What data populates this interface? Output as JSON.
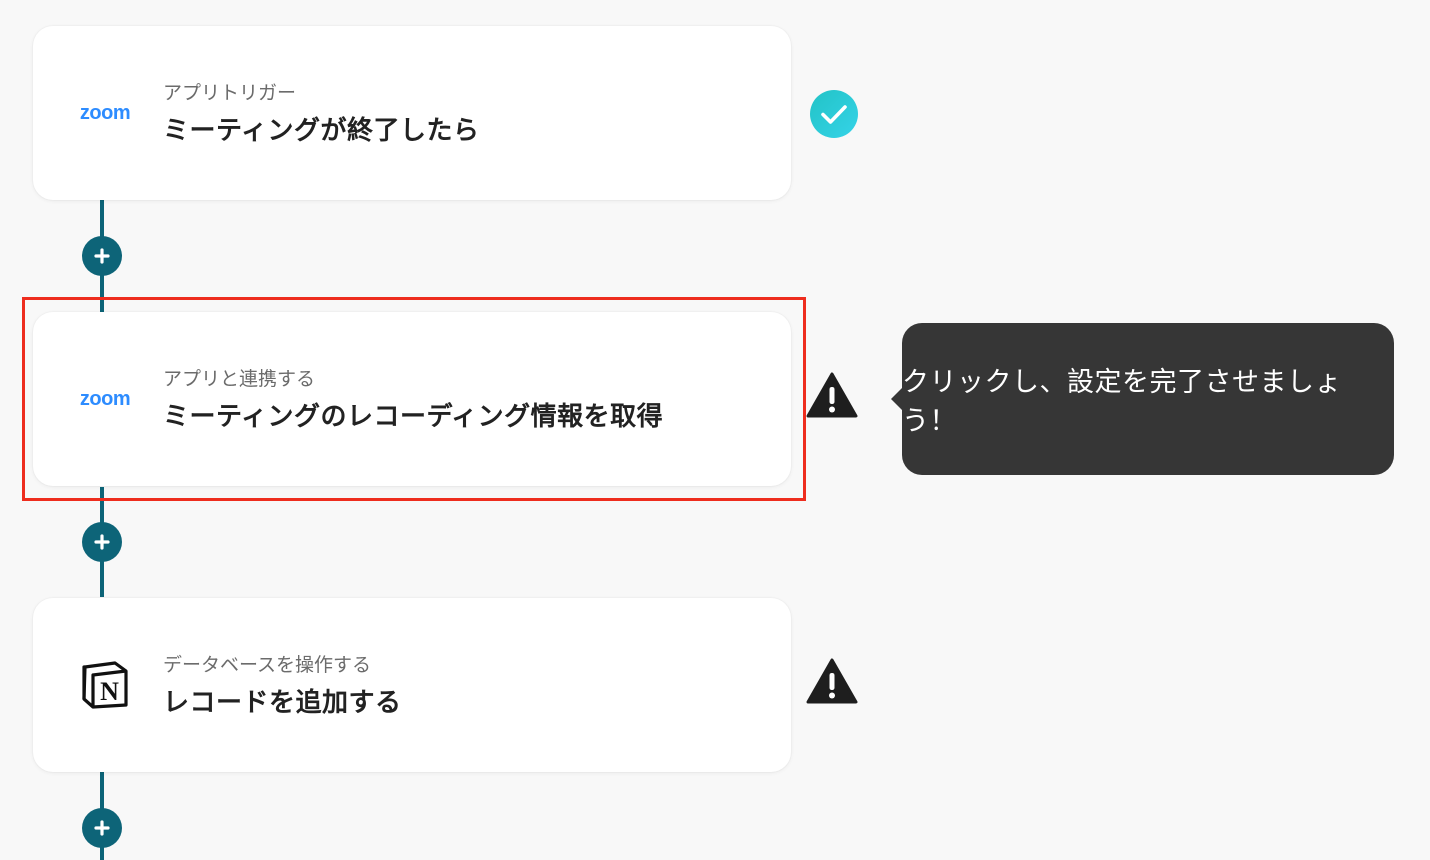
{
  "steps": [
    {
      "app": "zoom",
      "logo_text": "zoom",
      "logo_color": "#2d8cff",
      "subtitle": "アプリトリガー",
      "title": "ミーティングが終了したら",
      "status": "check-circle-icon"
    },
    {
      "app": "zoom",
      "logo_text": "zoom",
      "logo_color": "#2d8cff",
      "subtitle": "アプリと連携する",
      "title": "ミーティングのレコーディング情報を取得",
      "status": "warning-icon"
    },
    {
      "app": "notion",
      "logo_text": "N",
      "subtitle": "データベースを操作する",
      "title": "レコードを追加する",
      "status": "warning-icon"
    }
  ],
  "tooltip": {
    "text": "クリックし、設定を完了させましょう！"
  },
  "add_button": {
    "icon": "plus-icon"
  },
  "colors": {
    "connector": "#0d6478",
    "highlight_border": "#ee2d1e",
    "check_gradient_start": "#22c3c6",
    "check_gradient_end": "#31d1e6",
    "tooltip_bg": "#363636"
  }
}
